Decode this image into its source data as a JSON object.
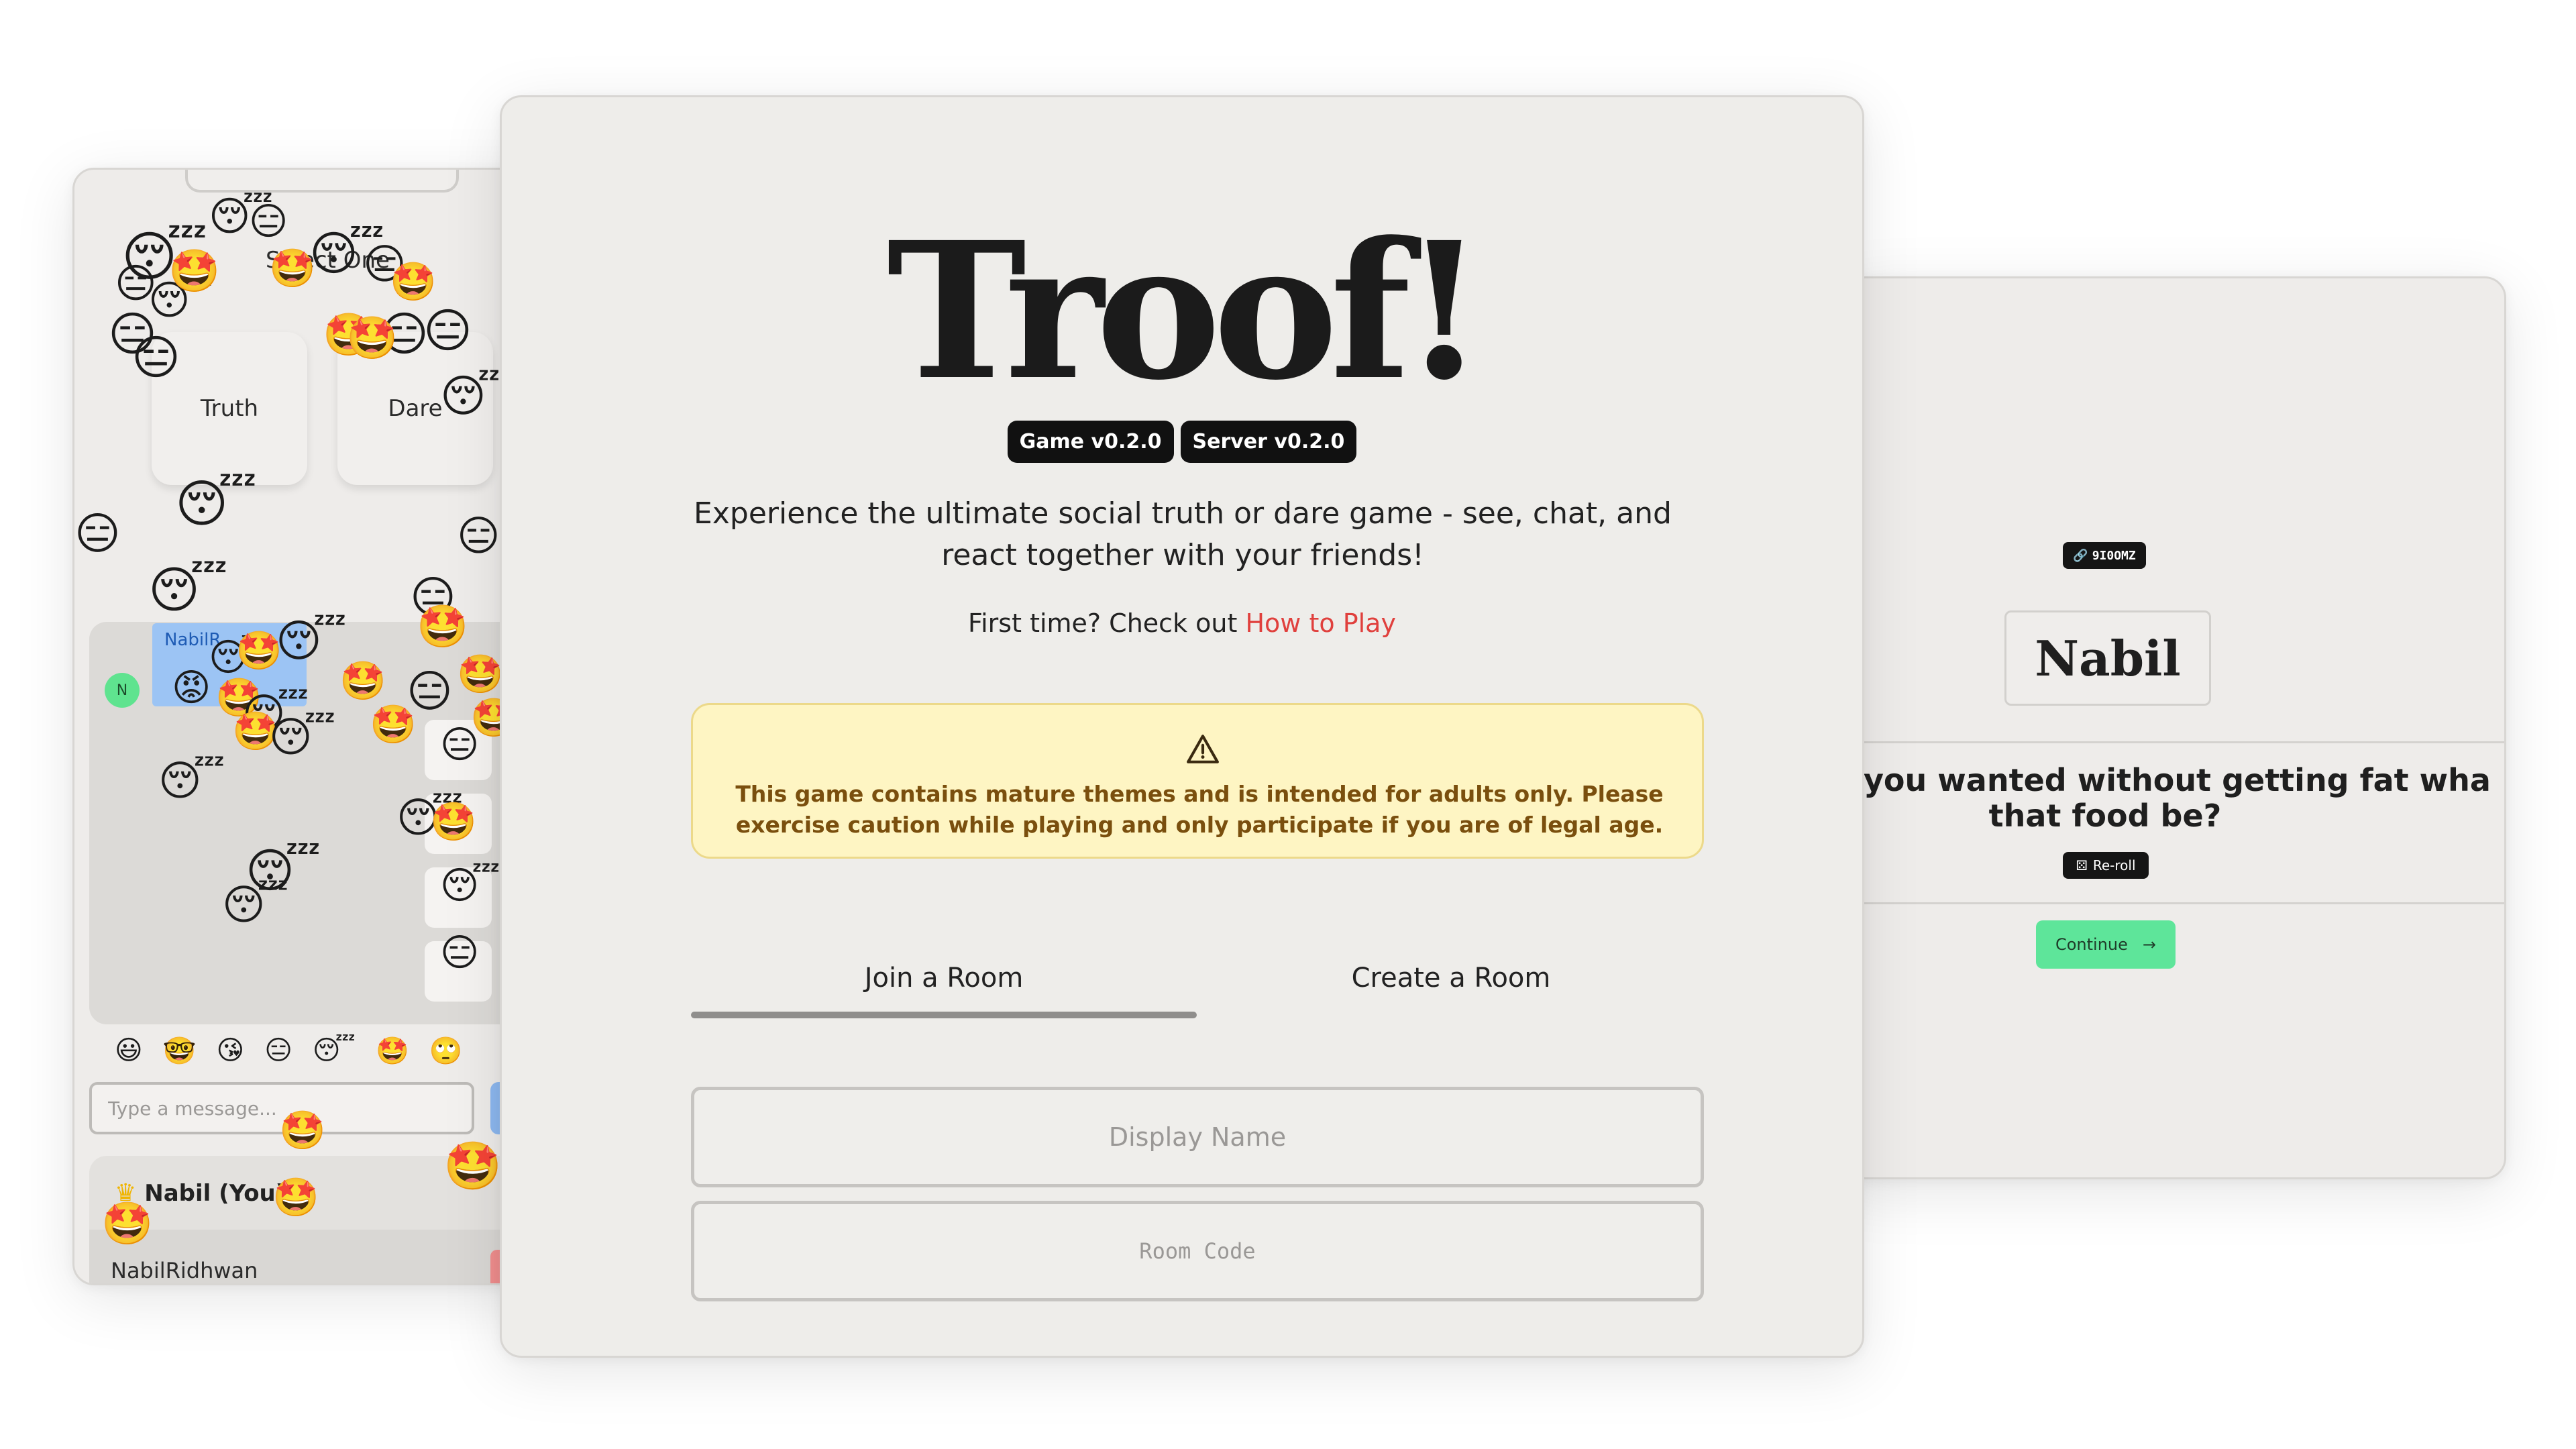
{
  "left_card": {
    "select_label": "Select One",
    "truth_label": "Truth",
    "dare_label": "Dare",
    "avatar_letter": "N",
    "bubble_name": "NabilR",
    "message_placeholder": "Type a message...",
    "quick_emojis": [
      "😃",
      "🤓",
      "😘",
      "😑",
      "😴",
      "🤩",
      "🙄"
    ],
    "host_name": "Nabil (You)",
    "player_name": "NabilRidhwan"
  },
  "center_card": {
    "title": "Troof!",
    "badges": [
      "Game v0.2.0",
      "Server v0.2.0"
    ],
    "description": "Experience the ultimate social truth or dare game - see, chat, and react together with your friends!",
    "first_time_text": "First time? Check out",
    "how_to_play_link": "How to Play",
    "warning_text": "This game contains mature themes and is intended for adults only. Please exercise caution while playing and only participate if you are of legal age.",
    "tabs": [
      "Join a Room",
      "Create a Room"
    ],
    "active_tab": "Join a Room",
    "display_name_placeholder": "Display Name",
    "room_code_placeholder": "Room Code"
  },
  "right_card": {
    "room_code": "9I0OMZ",
    "player_name": "Nabil",
    "question_line1": "nything you wanted without getting fat wha",
    "question_line2": "that food be?",
    "reroll_label": "Re-roll",
    "continue_label": "Continue",
    "colors": {
      "continue": "#5ee59a"
    }
  },
  "colors": {
    "card_bg": "#eeecea",
    "link": "#e0403d",
    "warning_bg": "#fef5c3",
    "warning_text": "#7a4f0e"
  }
}
